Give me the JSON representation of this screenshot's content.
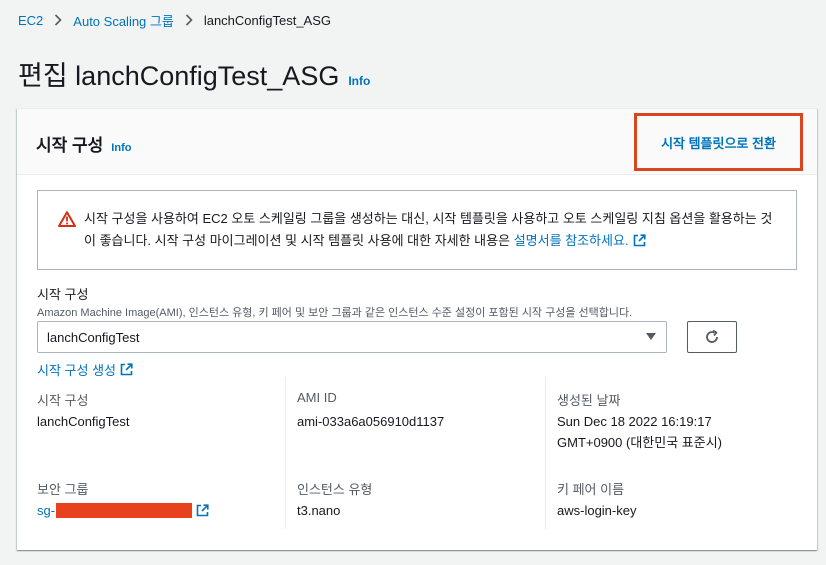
{
  "breadcrumb": {
    "items": [
      "EC2",
      "Auto Scaling 그룹"
    ],
    "current": "lanchConfigTest_ASG"
  },
  "page": {
    "title": "편집 lanchConfigTest_ASG",
    "info": "Info"
  },
  "panel": {
    "title": "시작 구성",
    "info": "Info",
    "switch_button": "시작 템플릿으로 전환",
    "alert": {
      "text": "시작 구성을 사용하여 EC2 오토 스케일링 그룹을 생성하는 대신, 시작 템플릿을 사용하고 오토 스케일링 지침 옵션을 활용하는 것이 좋습니다. 시작 구성 마이그레이션 및 시작 템플릿 사용에 대한 자세한 내용은 ",
      "link": "설명서를 참조하세요."
    },
    "field": {
      "label": "시작 구성",
      "description": "Amazon Machine Image(AMI), 인스턴스 유형, 키 페어 및 보안 그룹과 같은 인스턴스 수준 설정이 포함된 시작 구성을 선택합니다.",
      "selected": "lanchConfigTest",
      "create_link": "시작 구성 생성"
    },
    "details": {
      "launch_config_label": "시작 구성",
      "launch_config_value": "lanchConfigTest",
      "ami_label": "AMI ID",
      "ami_value": "ami-033a6a056910d1137",
      "created_label": "생성된 날짜",
      "created_value_line1": "Sun Dec 18 2022 16:19:17",
      "created_value_line2": "GMT+0900 (대한민국 표준시)",
      "sg_label": "보안 그룹",
      "sg_value": "sg-",
      "instance_type_label": "인스턴스 유형",
      "instance_type_value": "t3.nano",
      "key_pair_label": "키 페어 이름",
      "key_pair_value": "aws-login-key"
    }
  },
  "colors": {
    "link": "#0073bb",
    "highlight_border": "#d9461e",
    "redaction": "#e8411e",
    "warning": "#d13212"
  }
}
